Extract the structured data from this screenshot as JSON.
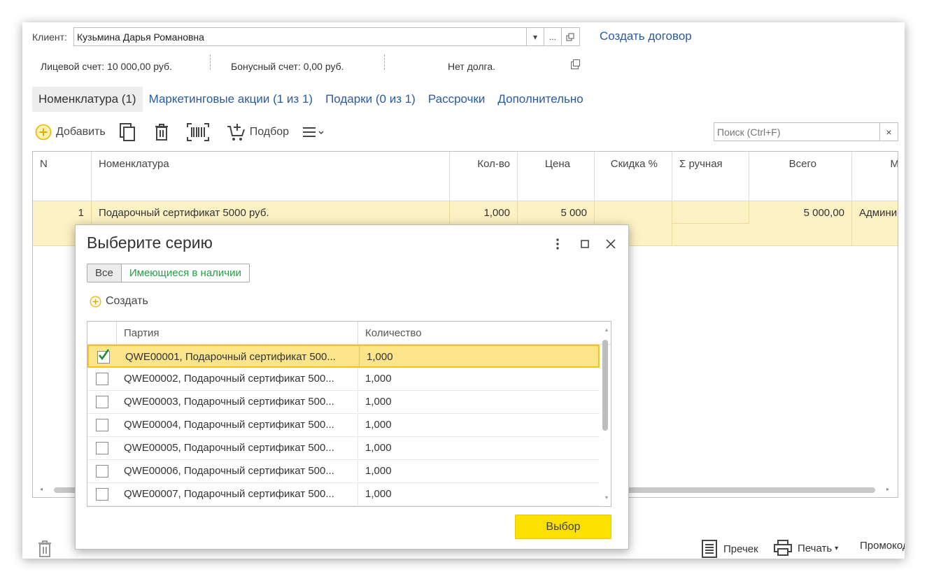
{
  "client": {
    "label": "Клиент:",
    "value": "Кузьмина Дарья Романовна",
    "dropdown": "▾",
    "more": "...",
    "create_contract": "Создать договор"
  },
  "info": {
    "personal_account": "Лицевой счет: 10 000,00  руб.",
    "bonus_account": "Бонусный счет: 0,00  руб.",
    "debt": "Нет долга."
  },
  "tabs": [
    {
      "label": "Номенклатура (1)"
    },
    {
      "label": "Маркетинговые акции (1 из 1)"
    },
    {
      "label": "Подарки (0 из 1)"
    },
    {
      "label": "Рассрочки"
    },
    {
      "label": "Дополнительно"
    }
  ],
  "toolbar": {
    "add_label": "Добавить",
    "pick_label": "Подбор",
    "search_placeholder": "Поиск (Ctrl+F)",
    "clear": "×"
  },
  "grid": {
    "columns": [
      "N",
      "Номенклатура",
      "Кол-во",
      "Цена",
      "Скидка %",
      "Σ ручная",
      "Всего",
      "М"
    ],
    "row": {
      "n": "1",
      "name": "Подарочный сертификат 5000 руб.",
      "qty": "1,000",
      "price": "5 000",
      "discount": "",
      "manual": "",
      "total": "5 000,00",
      "manager": "Админи"
    }
  },
  "bottom": {
    "precheck": "Пречек",
    "print": "Печать",
    "promo": "Промокод"
  },
  "modal": {
    "title": "Выберите серию",
    "seg_all": "Все",
    "seg_available": "Имеющиеся в наличии",
    "create_label": "Создать",
    "columns": [
      "Партия",
      "Количество"
    ],
    "rows": [
      {
        "batch": "QWE00001, Подарочный сертификат 500...",
        "qty": "1,000",
        "checked": true
      },
      {
        "batch": "QWE00002, Подарочный сертификат 500...",
        "qty": "1,000",
        "checked": false
      },
      {
        "batch": "QWE00003, Подарочный сертификат 500...",
        "qty": "1,000",
        "checked": false
      },
      {
        "batch": "QWE00004, Подарочный сертификат 500...",
        "qty": "1,000",
        "checked": false
      },
      {
        "batch": "QWE00005, Подарочный сертификат 500...",
        "qty": "1,000",
        "checked": false
      },
      {
        "batch": "QWE00006, Подарочный сертификат 500...",
        "qty": "1,000",
        "checked": false
      },
      {
        "batch": "QWE00007, Подарочный сертификат 500...",
        "qty": "1,000",
        "checked": false
      }
    ],
    "choose_label": "Выбор"
  },
  "colors": {
    "link": "#2a5aa0",
    "selected_row": "#fdf2c4",
    "accent_yellow": "#fbe000",
    "green": "#23a041"
  }
}
